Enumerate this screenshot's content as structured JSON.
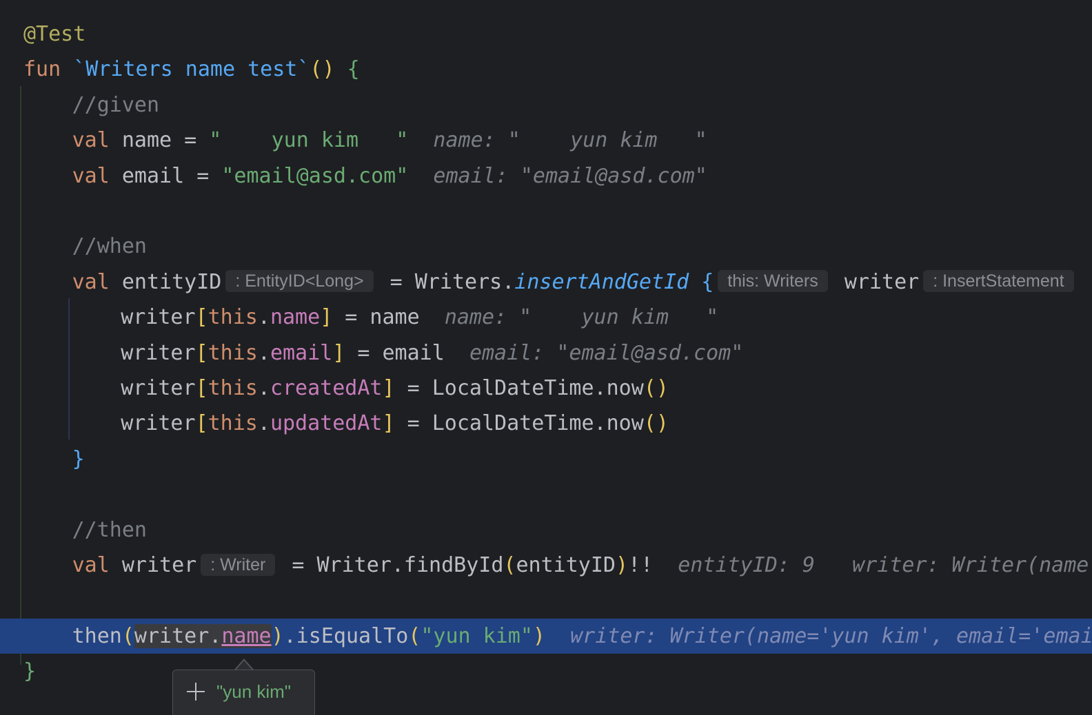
{
  "editor": {
    "language": "Kotlin",
    "lines": [
      {
        "indent": 1,
        "current": false,
        "tokens": [
          {
            "t": "@Test",
            "c": "ann",
            "name": "annotation"
          }
        ]
      },
      {
        "indent": 1,
        "current": false,
        "tokens": [
          {
            "t": "fun",
            "c": "kw",
            "name": "keyword"
          },
          {
            "t": " "
          },
          {
            "t": "`Writers name test`",
            "c": "fnname",
            "name": "function-name"
          },
          {
            "t": "()",
            "c": "br1",
            "name": "bracket"
          },
          {
            "t": " "
          },
          {
            "t": "{",
            "c": "br3",
            "name": "bracket"
          }
        ]
      },
      {
        "indent": 5,
        "current": false,
        "tokens": [
          {
            "t": "//given",
            "c": "com",
            "name": "comment"
          }
        ]
      },
      {
        "indent": 5,
        "current": false,
        "tokens": [
          {
            "t": "val",
            "c": "kw",
            "name": "keyword"
          },
          {
            "t": " name = "
          },
          {
            "t": "\"    yun kim   \"",
            "c": "str",
            "name": "string-literal"
          },
          {
            "t": "  "
          },
          {
            "t": "name: \"    yun kim   \"",
            "c": "hint",
            "name": "debug-value-hint"
          }
        ]
      },
      {
        "indent": 5,
        "current": false,
        "tokens": [
          {
            "t": "val",
            "c": "kw",
            "name": "keyword"
          },
          {
            "t": " email = "
          },
          {
            "t": "\"email@asd.com\"",
            "c": "str",
            "name": "string-literal"
          },
          {
            "t": "  "
          },
          {
            "t": "email: \"email@asd.com\"",
            "c": "hint",
            "name": "debug-value-hint"
          }
        ]
      },
      {
        "indent": 0,
        "current": false,
        "tokens": []
      },
      {
        "indent": 5,
        "current": false,
        "tokens": [
          {
            "t": "//when",
            "c": "com",
            "name": "comment"
          }
        ]
      },
      {
        "indent": 5,
        "current": false,
        "tokens": [
          {
            "t": "val",
            "c": "kw",
            "name": "keyword"
          },
          {
            "t": " entityID"
          },
          {
            "t": ": EntityID<Long>",
            "c": "chip",
            "name": "type-hint-chip"
          },
          {
            "t": " = Writers."
          },
          {
            "t": "insertAndGetId",
            "c": "ital",
            "name": "function-call"
          },
          {
            "t": " "
          },
          {
            "t": "{",
            "c": "br2",
            "name": "bracket"
          },
          {
            "t": "this: Writers",
            "c": "chip",
            "name": "receiver-hint-chip"
          },
          {
            "t": " writer"
          },
          {
            "t": ": InsertStatement",
            "c": "chip",
            "name": "type-hint-chip"
          }
        ]
      },
      {
        "indent": 9,
        "current": false,
        "tokens": [
          {
            "t": "writer"
          },
          {
            "t": "[",
            "c": "br1",
            "name": "bracket"
          },
          {
            "t": "this",
            "c": "kw",
            "name": "keyword"
          },
          {
            "t": "."
          },
          {
            "t": "name",
            "c": "prop",
            "name": "property"
          },
          {
            "t": "]",
            "c": "br1",
            "name": "bracket"
          },
          {
            "t": " = name  "
          },
          {
            "t": "name: \"    yun kim   \"",
            "c": "hint",
            "name": "debug-value-hint"
          }
        ]
      },
      {
        "indent": 9,
        "current": false,
        "tokens": [
          {
            "t": "writer"
          },
          {
            "t": "[",
            "c": "br1",
            "name": "bracket"
          },
          {
            "t": "this",
            "c": "kw",
            "name": "keyword"
          },
          {
            "t": "."
          },
          {
            "t": "email",
            "c": "prop",
            "name": "property"
          },
          {
            "t": "]",
            "c": "br1",
            "name": "bracket"
          },
          {
            "t": " = email  "
          },
          {
            "t": "email: \"email@asd.com\"",
            "c": "hint",
            "name": "debug-value-hint"
          }
        ]
      },
      {
        "indent": 9,
        "current": false,
        "tokens": [
          {
            "t": "writer"
          },
          {
            "t": "[",
            "c": "br1",
            "name": "bracket"
          },
          {
            "t": "this",
            "c": "kw",
            "name": "keyword"
          },
          {
            "t": "."
          },
          {
            "t": "createdAt",
            "c": "prop",
            "name": "property"
          },
          {
            "t": "]",
            "c": "br1",
            "name": "bracket"
          },
          {
            "t": " = LocalDateTime.now"
          },
          {
            "t": "()",
            "c": "br1",
            "name": "bracket"
          }
        ]
      },
      {
        "indent": 9,
        "current": false,
        "tokens": [
          {
            "t": "writer"
          },
          {
            "t": "[",
            "c": "br1",
            "name": "bracket"
          },
          {
            "t": "this",
            "c": "kw",
            "name": "keyword"
          },
          {
            "t": "."
          },
          {
            "t": "updatedAt",
            "c": "prop",
            "name": "property"
          },
          {
            "t": "]",
            "c": "br1",
            "name": "bracket"
          },
          {
            "t": " = LocalDateTime.now"
          },
          {
            "t": "()",
            "c": "br1",
            "name": "bracket"
          }
        ]
      },
      {
        "indent": 5,
        "current": false,
        "tokens": [
          {
            "t": "}",
            "c": "br2",
            "name": "bracket"
          }
        ]
      },
      {
        "indent": 0,
        "current": false,
        "tokens": []
      },
      {
        "indent": 5,
        "current": false,
        "tokens": [
          {
            "t": "//then",
            "c": "com",
            "name": "comment"
          }
        ]
      },
      {
        "indent": 5,
        "current": false,
        "tokens": [
          {
            "t": "val",
            "c": "kw",
            "name": "keyword"
          },
          {
            "t": " writer"
          },
          {
            "t": ": Writer",
            "c": "chip",
            "name": "type-hint-chip"
          },
          {
            "t": " = Writer.findById"
          },
          {
            "t": "(",
            "c": "br1",
            "name": "bracket"
          },
          {
            "t": "entityID"
          },
          {
            "t": ")",
            "c": "br1",
            "name": "bracket"
          },
          {
            "t": "!!  "
          },
          {
            "t": "entityID: 9   writer: Writer(name",
            "c": "hint",
            "name": "debug-value-hint"
          }
        ]
      },
      {
        "indent": 0,
        "current": false,
        "tokens": []
      },
      {
        "indent": 5,
        "current": true,
        "tokens": [
          {
            "t": "then"
          },
          {
            "t": "(",
            "c": "br1",
            "name": "bracket"
          },
          {
            "t": "writer.",
            "c": "ref-hl",
            "name": "selected-expression"
          },
          {
            "t": "name",
            "c": "prop ref-hl underline",
            "name": "selected-property"
          },
          {
            "t": ")",
            "c": "br1",
            "name": "bracket"
          },
          {
            "t": ".isEqualTo"
          },
          {
            "t": "(",
            "c": "br1",
            "name": "bracket"
          },
          {
            "t": "\"yun kim\"",
            "c": "str",
            "name": "string-literal"
          },
          {
            "t": ")",
            "c": "br1",
            "name": "bracket"
          },
          {
            "t": "  "
          },
          {
            "t": "writer: Writer(name='yun kim', email='emai",
            "c": "hint",
            "name": "debug-value-hint"
          }
        ]
      },
      {
        "indent": 1,
        "current": false,
        "tokens": [
          {
            "t": "}",
            "c": "br3",
            "name": "bracket"
          }
        ]
      }
    ]
  },
  "popup": {
    "icon": "plus-icon",
    "value": "\"yun kim\""
  }
}
